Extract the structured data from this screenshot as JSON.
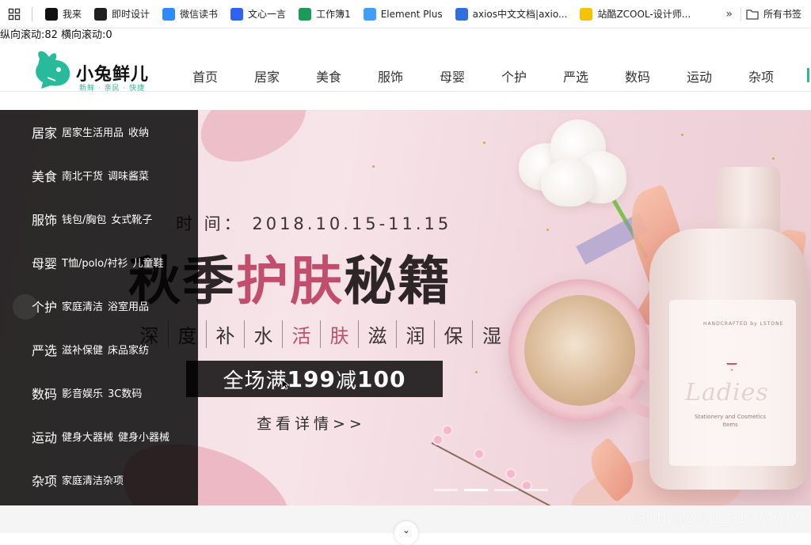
{
  "bookmarks": {
    "items": [
      {
        "label": "我来",
        "icon": "wolai-icon",
        "color": "#111111"
      },
      {
        "label": "即时设计",
        "icon": "jsdesign-icon",
        "color": "#1f1f1f"
      },
      {
        "label": "微信读书",
        "icon": "weread-icon",
        "color": "#2b8cff"
      },
      {
        "label": "文心一言",
        "icon": "wenxin-icon",
        "color": "#2f62f0"
      },
      {
        "label": "工作簿1",
        "icon": "sheet-icon",
        "color": "#1a9b5a"
      },
      {
        "label": "Element Plus",
        "icon": "element-plus-icon",
        "color": "#409eff"
      },
      {
        "label": "axios中文文档|axio...",
        "icon": "axios-icon",
        "color": "#2f6fe0"
      },
      {
        "label": "站酷ZCOOL-设计师...",
        "icon": "zcool-icon",
        "color": "#f5c400"
      }
    ],
    "more": "»",
    "folder": "所有书签"
  },
  "scroll_readout": "纵向滚动:82 横向滚动:0",
  "header": {
    "logo_title": "小兔鲜儿",
    "logo_sub": "新鲜 · 亲民 · 快捷",
    "nav": [
      "首页",
      "居家",
      "美食",
      "服饰",
      "母婴",
      "个护",
      "严选",
      "数码",
      "运动",
      "杂项"
    ]
  },
  "banner": {
    "time": "时 间： 2018.10.15-11.15",
    "title_a": "秋季",
    "title_b": "护肤",
    "title_c": "秘籍",
    "sub": [
      "深",
      "度",
      "补",
      "水",
      "活",
      "肤",
      "滋",
      "润",
      "保",
      "湿"
    ],
    "promo_a": "全场满",
    "promo_b": "199",
    "promo_c": "减",
    "promo_d": "100",
    "link": "查看详情>>",
    "bottle_small": "HANDCRAFTED by LSTONE",
    "bottle_brand": "Ladies",
    "bottle_tag": "Stationery and Cosmetics Items",
    "carousel_active": 1
  },
  "categories": [
    {
      "name": "居家",
      "subs": [
        "居家生活用品",
        "收纳"
      ]
    },
    {
      "name": "美食",
      "subs": [
        "南北干货",
        "调味酱菜"
      ]
    },
    {
      "name": "服饰",
      "subs": [
        "钱包/胸包",
        "女式靴子"
      ]
    },
    {
      "name": "母婴",
      "subs": [
        "T恤/polo/衬衫",
        "儿童鞋"
      ]
    },
    {
      "name": "个护",
      "subs": [
        "家庭清洁",
        "浴室用品"
      ]
    },
    {
      "name": "严选",
      "subs": [
        "滋补保健",
        "床品家纺"
      ]
    },
    {
      "name": "数码",
      "subs": [
        "影音娱乐",
        "3C数码"
      ]
    },
    {
      "name": "运动",
      "subs": [
        "健身大器械",
        "健身小器械"
      ]
    },
    {
      "name": "杂项",
      "subs": [
        "家庭清洁杂项"
      ]
    }
  ],
  "watermark": "CSDN @2301_81277777",
  "colors": {
    "brand": "#27ba9b",
    "accent": "#c14e6c"
  }
}
